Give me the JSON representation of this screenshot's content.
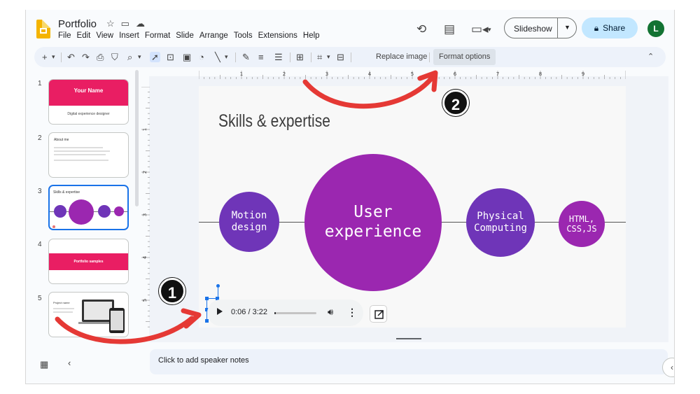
{
  "header": {
    "title": "Portfolio",
    "menu": [
      "File",
      "Edit",
      "View",
      "Insert",
      "Format",
      "Slide",
      "Arrange",
      "Tools",
      "Extensions",
      "Help"
    ],
    "slideshow_label": "Slideshow",
    "share_label": "Share",
    "avatar_initial": "L"
  },
  "toolbar": {
    "replace_image_label": "Replace image",
    "format_options_label": "Format options"
  },
  "filmstrip": {
    "slides": [
      {
        "num": "1",
        "title": "Your Name",
        "subtitle": "Digital experience designer"
      },
      {
        "num": "2",
        "title": "About me"
      },
      {
        "num": "3",
        "title": "Skills & expertise"
      },
      {
        "num": "4",
        "title": "Portfolio samples"
      },
      {
        "num": "5",
        "title": "Project name"
      }
    ]
  },
  "ruler": {
    "horizontal": [
      "1",
      "2",
      "3",
      "4",
      "5",
      "6",
      "7",
      "8",
      "9"
    ],
    "vertical": [
      "1",
      "2",
      "3",
      "4",
      "5"
    ]
  },
  "slide": {
    "heading": "Skills & expertise",
    "bubbles": [
      {
        "line1": "Motion",
        "line2": "design"
      },
      {
        "line1": "User",
        "line2": "experience"
      },
      {
        "line1": "Physical",
        "line2": "Computing"
      },
      {
        "line1": "HTML,",
        "line2": "CSS,JS"
      }
    ]
  },
  "audio": {
    "time": "0:06 / 3:22",
    "progress_fraction": 0.03
  },
  "notes": {
    "placeholder": "Click to add speaker notes"
  },
  "annotations": {
    "marker_1": "1",
    "marker_2": "2"
  },
  "colors": {
    "accent_pink": "#e91e63",
    "bubble_purple": "#6f35b8",
    "bubble_magenta": "#9b27b0",
    "annotation_red": "#e53935",
    "selection_blue": "#1a73e8"
  }
}
